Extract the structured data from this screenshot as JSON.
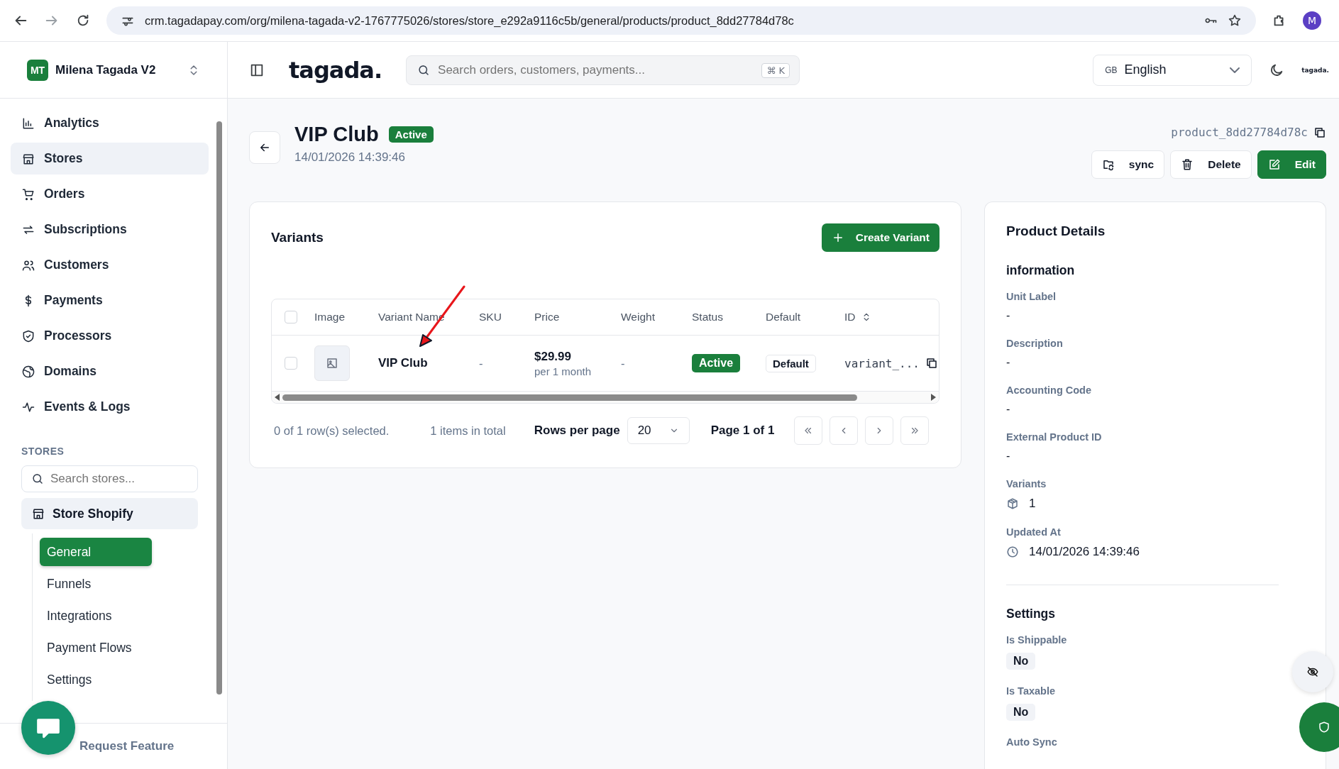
{
  "browser": {
    "url": "crm.tagadapay.com/org/milena-tagada-v2-1767775026/stores/store_e292a9116c5b/general/products/product_8dd27784d78c",
    "profile": "M"
  },
  "sidebar": {
    "org": {
      "initials": "MT",
      "name": "Milena Tagada V2"
    },
    "nav": [
      {
        "label": "Analytics",
        "selected": false
      },
      {
        "label": "Stores",
        "selected": true
      },
      {
        "label": "Orders",
        "selected": false
      },
      {
        "label": "Subscriptions",
        "selected": false
      },
      {
        "label": "Customers",
        "selected": false
      },
      {
        "label": "Payments",
        "selected": false
      },
      {
        "label": "Processors",
        "selected": false
      },
      {
        "label": "Domains",
        "selected": false
      },
      {
        "label": "Events & Logs",
        "selected": false
      }
    ],
    "stores_heading": "STORES",
    "store_search": {
      "placeholder": "Search stores..."
    },
    "store": {
      "name": "Store Shopify"
    },
    "store_nav": [
      {
        "label": "General",
        "selected": true
      },
      {
        "label": "Funnels",
        "selected": false
      },
      {
        "label": "Integrations",
        "selected": false
      },
      {
        "label": "Payment Flows",
        "selected": false
      },
      {
        "label": "Settings",
        "selected": false
      }
    ],
    "footer": "Request Feature"
  },
  "header": {
    "logo": "tagada.",
    "search": {
      "placeholder": "Search orders, customers, payments...",
      "shortcut": "⌘ K"
    },
    "language": {
      "flag": "GB",
      "label": "English"
    },
    "corner_logo": "tagada."
  },
  "product": {
    "title": "VIP Club",
    "status": "Active",
    "date": "14/01/2026 14:39:46",
    "id": "product_8dd27784d78c",
    "actions": [
      {
        "label": "sync",
        "kind": "sync"
      },
      {
        "label": "Delete",
        "kind": "delete"
      },
      {
        "label": "Edit",
        "kind": "edit"
      }
    ]
  },
  "variants": {
    "title": "Variants",
    "create": "Create Variant",
    "select_all": {
      "checked": false
    },
    "columns": [
      {
        "label": "Image",
        "sortable": false
      },
      {
        "label": "Variant Name",
        "sortable": false
      },
      {
        "label": "SKU",
        "sortable": false
      },
      {
        "label": "Price",
        "sortable": false
      },
      {
        "label": "Weight",
        "sortable": false
      },
      {
        "label": "Status",
        "sortable": false
      },
      {
        "label": "Default",
        "sortable": false
      },
      {
        "label": "ID",
        "sortable": true
      }
    ],
    "rows": [
      {
        "name": "VIP Club",
        "sku": "-",
        "price": "$29.99",
        "period": "per 1 month",
        "weight": "-",
        "status": "Active",
        "default": "Default",
        "id": "variant_...",
        "selected": false
      }
    ],
    "footer": {
      "selection": "0 of 1 row(s) selected.",
      "total": "1 items in total",
      "rows_label": "Rows per page",
      "rows_value": "20",
      "page": "Page 1 of 1"
    }
  },
  "details": {
    "title": "Product Details",
    "sections": [
      {
        "heading": "information",
        "fields": [
          {
            "label": "Unit Label",
            "value": "-",
            "kind": "text"
          },
          {
            "label": "Description",
            "value": "-",
            "kind": "text"
          },
          {
            "label": "Accounting Code",
            "value": "-",
            "kind": "text"
          },
          {
            "label": "External Product ID",
            "value": "-",
            "kind": "text"
          },
          {
            "label": "Variants",
            "value": "1",
            "kind": "count"
          },
          {
            "label": "Updated At",
            "value": "14/01/2026 14:39:46",
            "kind": "date"
          }
        ]
      },
      {
        "heading": "Settings",
        "fields": [
          {
            "label": "Is Shippable",
            "value": "No",
            "kind": "badge"
          },
          {
            "label": "Is Taxable",
            "value": "No",
            "kind": "badge"
          },
          {
            "label": "Auto Sync"
          }
        ]
      }
    ]
  }
}
